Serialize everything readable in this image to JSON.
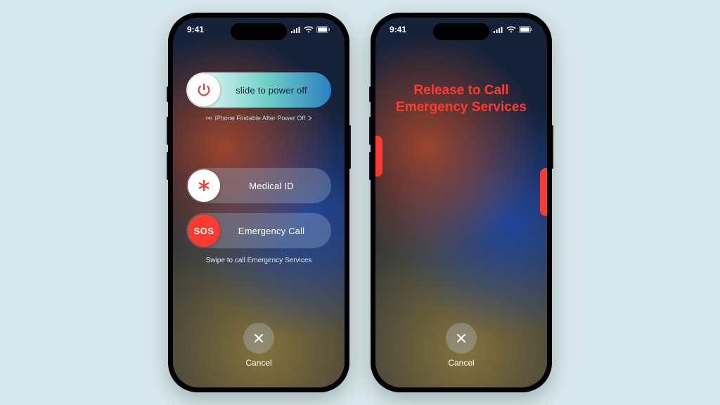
{
  "status": {
    "time": "9:41"
  },
  "phone1": {
    "power_slider_label": "slide to power off",
    "findable_text": "iPhone Findable After Power Off",
    "medical_label": "Medical ID",
    "emergency_label": "Emergency Call",
    "sos_text": "SOS",
    "swipe_hint": "Swipe to call Emergency Services",
    "cancel_label": "Cancel"
  },
  "phone2": {
    "release_line1": "Release to Call",
    "release_line2": "Emergency Services",
    "cancel_label": "Cancel"
  },
  "colors": {
    "sos_red": "#ff3b30",
    "power_red": "#e53a2f"
  }
}
